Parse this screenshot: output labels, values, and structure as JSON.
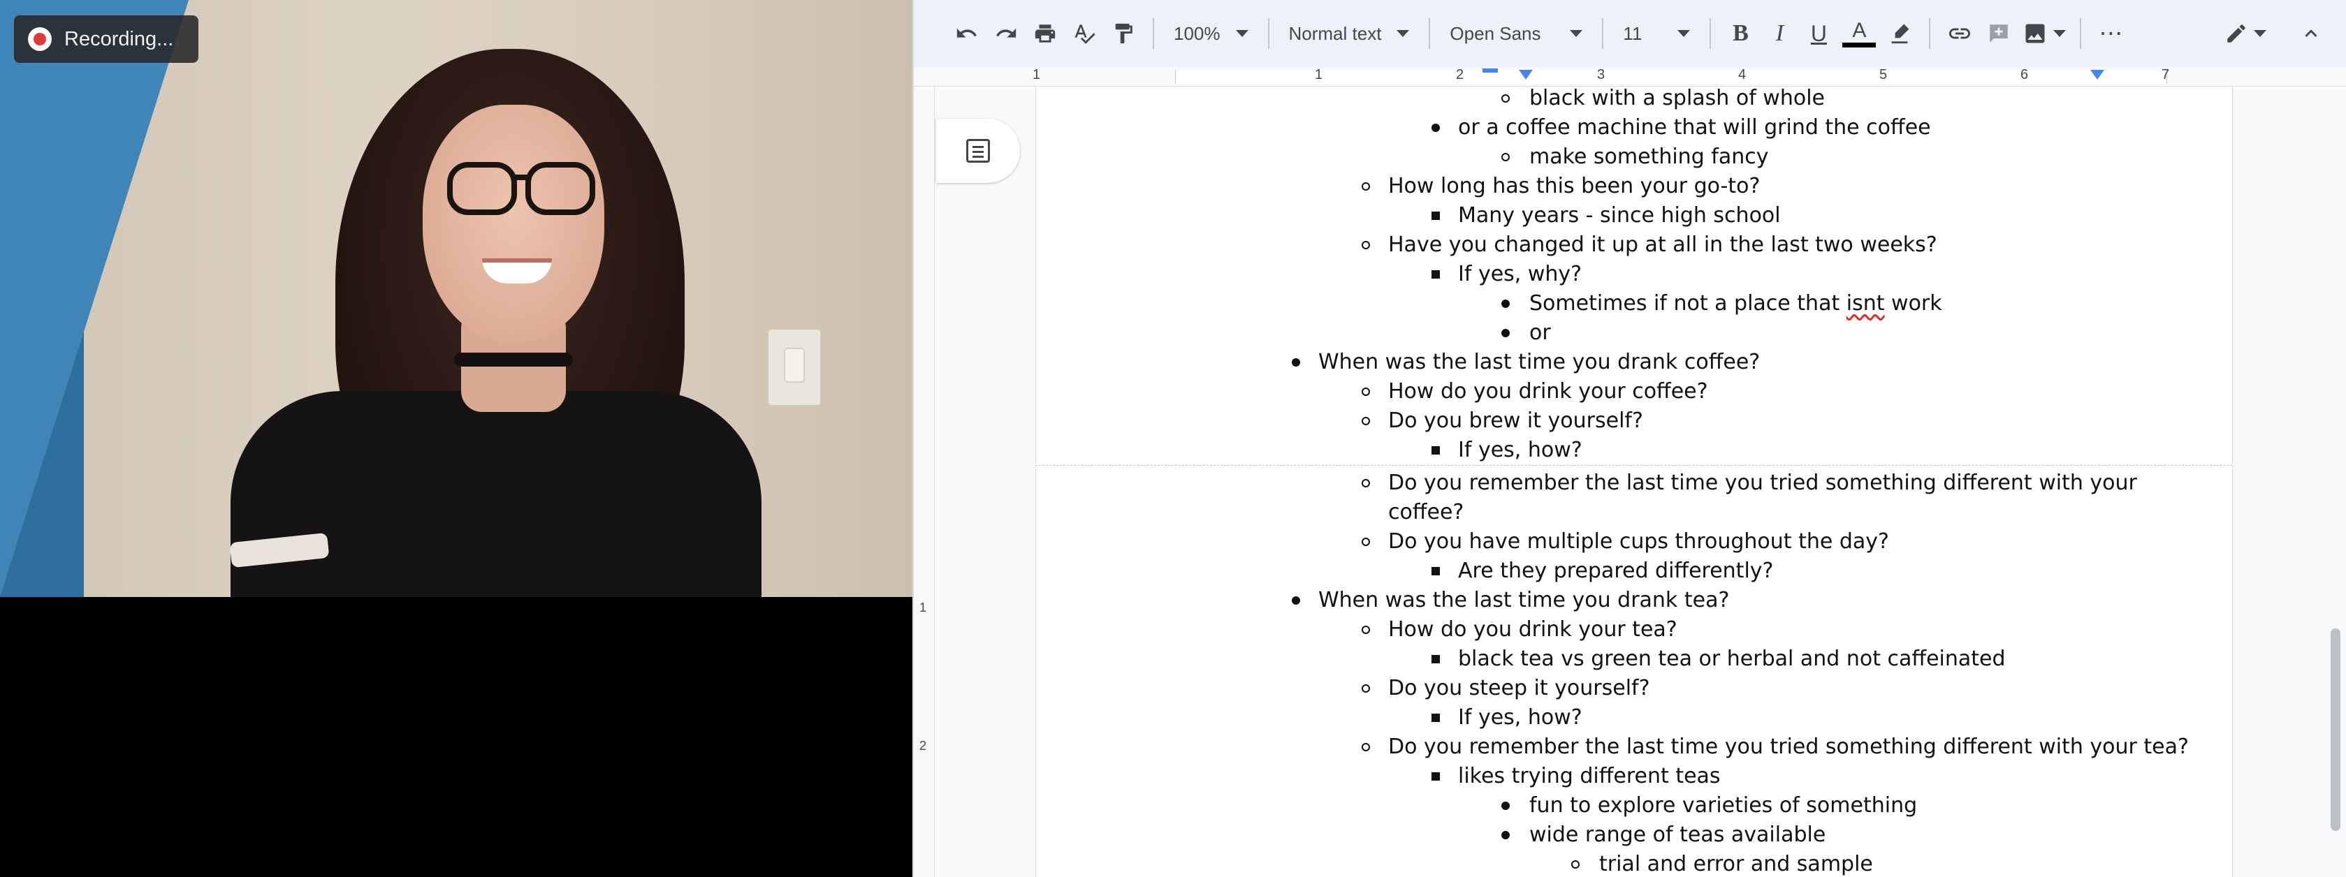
{
  "video": {
    "recording_label": "Recording..."
  },
  "toolbar": {
    "zoom": "100%",
    "style": "Normal text",
    "font": "Open Sans",
    "size": "11",
    "bold_label": "B",
    "italic_label": "I",
    "underline_label": "U",
    "textcolor_label": "A",
    "more_label": "⋯"
  },
  "ruler": {
    "marks": [
      "1",
      "1",
      "2",
      "3",
      "4",
      "5",
      "6",
      "7"
    ]
  },
  "vruler": {
    "marks": [
      "1",
      "2"
    ]
  },
  "document": {
    "lines": [
      {
        "text": "black with a splash of whole",
        "level": 3,
        "bullet": "circle"
      },
      {
        "text": "or a coffee machine that will grind the coffee",
        "level": 2,
        "bullet": "disc"
      },
      {
        "text": "make something fancy",
        "level": 3,
        "bullet": "circle"
      },
      {
        "text": "How long has this been your go-to?",
        "level": 1,
        "bullet": "circle"
      },
      {
        "text": "Many years - since high school",
        "level": 2,
        "bullet": "square"
      },
      {
        "text": "Have you changed it up at all in the last two weeks?",
        "level": 1,
        "bullet": "circle"
      },
      {
        "text": "If yes, why?",
        "level": 2,
        "bullet": "square"
      },
      {
        "text_a": "Sometimes if not a place that ",
        "text_spell": "isnt",
        "text_b": " work",
        "level": 3,
        "bullet": "disc"
      },
      {
        "text": "or",
        "level": 3,
        "bullet": "disc"
      },
      {
        "text": "When was the last time you drank coffee?",
        "level": 0,
        "bullet": "disc"
      },
      {
        "text": "How do you drink your coffee?",
        "level": 1,
        "bullet": "circle"
      },
      {
        "text": "Do you brew it yourself?",
        "level": 1,
        "bullet": "circle"
      },
      {
        "text": "If yes, how?",
        "level": 2,
        "bullet": "square"
      }
    ],
    "lines_page2": [
      {
        "text": "Do you remember the last time you tried something different with your",
        "level": 1,
        "bullet": "circle"
      },
      {
        "text": "coffee?",
        "level": 1,
        "bullet": "none"
      },
      {
        "text": "Do you have multiple cups throughout the day?",
        "level": 1,
        "bullet": "circle"
      },
      {
        "text": "Are they prepared differently?",
        "level": 2,
        "bullet": "square"
      },
      {
        "text": "When was the last time you drank tea?",
        "level": 0,
        "bullet": "disc"
      },
      {
        "text": "How do you drink your tea?",
        "level": 1,
        "bullet": "circle"
      },
      {
        "text": "black tea vs green tea or herbal and not caffeinated",
        "level": 2,
        "bullet": "square"
      },
      {
        "text": "Do you steep it yourself?",
        "level": 1,
        "bullet": "circle"
      },
      {
        "text": "If yes, how?",
        "level": 2,
        "bullet": "square"
      },
      {
        "text": "Do you remember the last time you tried something different with your tea?",
        "level": 1,
        "bullet": "circle"
      },
      {
        "text": "likes trying different teas",
        "level": 2,
        "bullet": "square"
      },
      {
        "text": "fun to explore varieties of something",
        "level": 3,
        "bullet": "disc"
      },
      {
        "text": "wide range of teas available",
        "level": 3,
        "bullet": "disc"
      },
      {
        "text": "trial and error and sample",
        "level": 4,
        "bullet": "circle"
      }
    ]
  }
}
